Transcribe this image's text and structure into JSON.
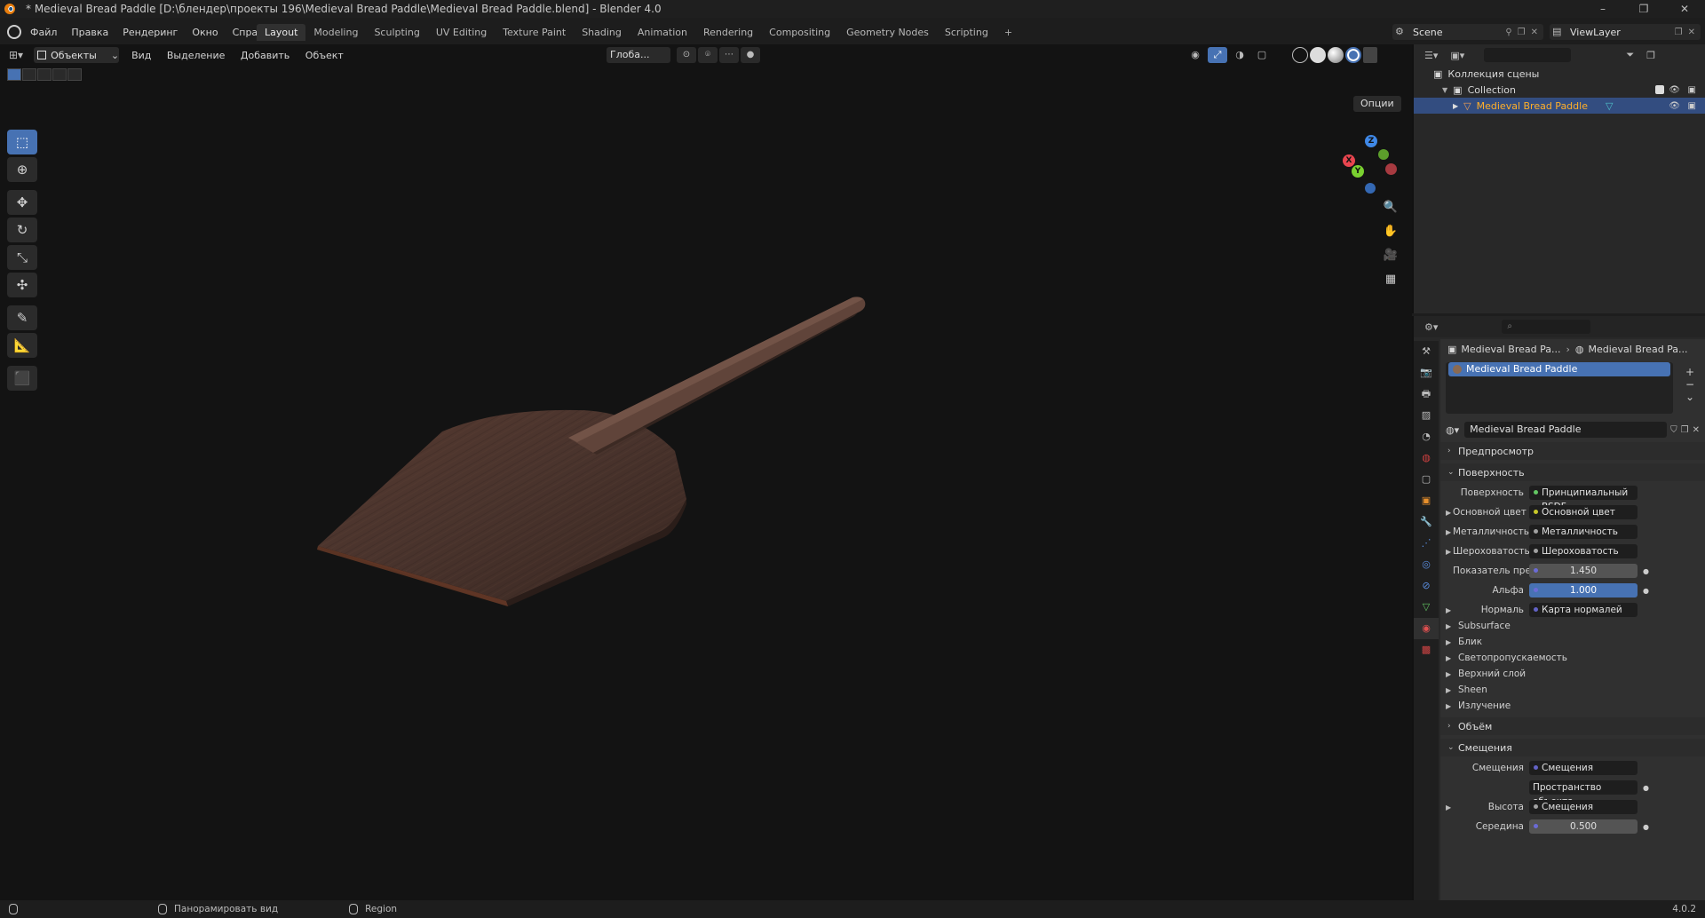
{
  "window": {
    "title": "* Medieval Bread Paddle [D:\\блендер\\проекты 196\\Medieval Bread Paddle\\Medieval Bread Paddle.blend] - Blender 4.0",
    "minimize": "–",
    "maximize": "❐",
    "close": "✕"
  },
  "menu": [
    "Файл",
    "Правка",
    "Рендеринг",
    "Окно",
    "Справка"
  ],
  "workspaces": [
    "Layout",
    "Modeling",
    "Sculpting",
    "UV Editing",
    "Texture Paint",
    "Shading",
    "Animation",
    "Rendering",
    "Compositing",
    "Geometry Nodes",
    "Scripting"
  ],
  "active_workspace": "Layout",
  "add_workspace": "+",
  "scene": {
    "label": "Scene",
    "viewlayer": "ViewLayer"
  },
  "viewport": {
    "mode": "Объекты",
    "menus": [
      "Вид",
      "Выделение",
      "Добавить",
      "Объект"
    ],
    "transform_orientation": "Глоба...",
    "options": "Опции",
    "gizmo": {
      "x": "X",
      "y": "Y",
      "z": "Z"
    }
  },
  "outliner": {
    "search_placeholder": "",
    "rows": [
      {
        "label": "Коллекция сцены"
      },
      {
        "label": "Collection"
      },
      {
        "label": "Medieval Bread Paddle"
      }
    ]
  },
  "properties": {
    "breadcrumb_object": "Medieval Bread Pa...",
    "breadcrumb_material": "Medieval Bread Pa...",
    "material_slot": "Medieval Bread Paddle",
    "material_name": "Medieval Bread Paddle",
    "panels": {
      "preview": "Предпросмотр",
      "surface": "Поверхность",
      "volume": "Объём",
      "displacement": "Смещения"
    },
    "surface_rows": [
      {
        "label": "Поверхность",
        "value": "Принципиальный BSDF",
        "dot": "#63c763"
      },
      {
        "label": "Основной цвет",
        "value": "Основной цвет",
        "dot": "#c7c729",
        "tri": true
      },
      {
        "label": "Металличность",
        "value": "Металличность",
        "dot": "#a1a1a1",
        "tri": true
      },
      {
        "label": "Шероховатость",
        "value": "Шероховатость",
        "dot": "#a1a1a1",
        "tri": true
      },
      {
        "label": "Показатель прело...",
        "value": "1.450",
        "num": true
      },
      {
        "label": "Альфа",
        "value": "1.000",
        "num": true,
        "blue": true
      },
      {
        "label": "Нормаль",
        "value": "Карта нормалей",
        "dot": "#6363c7",
        "tri": true
      }
    ],
    "subpanels": [
      "Subsurface",
      "Блик",
      "Светопропускаемость",
      "Верхний слой",
      "Sheen",
      "Излучение"
    ],
    "displacement_rows": [
      {
        "label": "Смещения",
        "value": "Смещения",
        "dot": "#6363c7"
      },
      {
        "label": "",
        "value": "Пространство объекта",
        "dropdown": true
      },
      {
        "label": "Высота",
        "value": "Смещения",
        "dot": "#a1a1a1",
        "tri": true
      },
      {
        "label": "Середина",
        "value": "0.500",
        "num": true
      }
    ]
  },
  "status": {
    "pan_view": "Панорамировать вид",
    "region": "Region",
    "version": "4.0.2"
  },
  "colors": {
    "accent": "#4772b3",
    "wood_dark": "#3f2b24",
    "wood_light": "#6a4a3c"
  }
}
